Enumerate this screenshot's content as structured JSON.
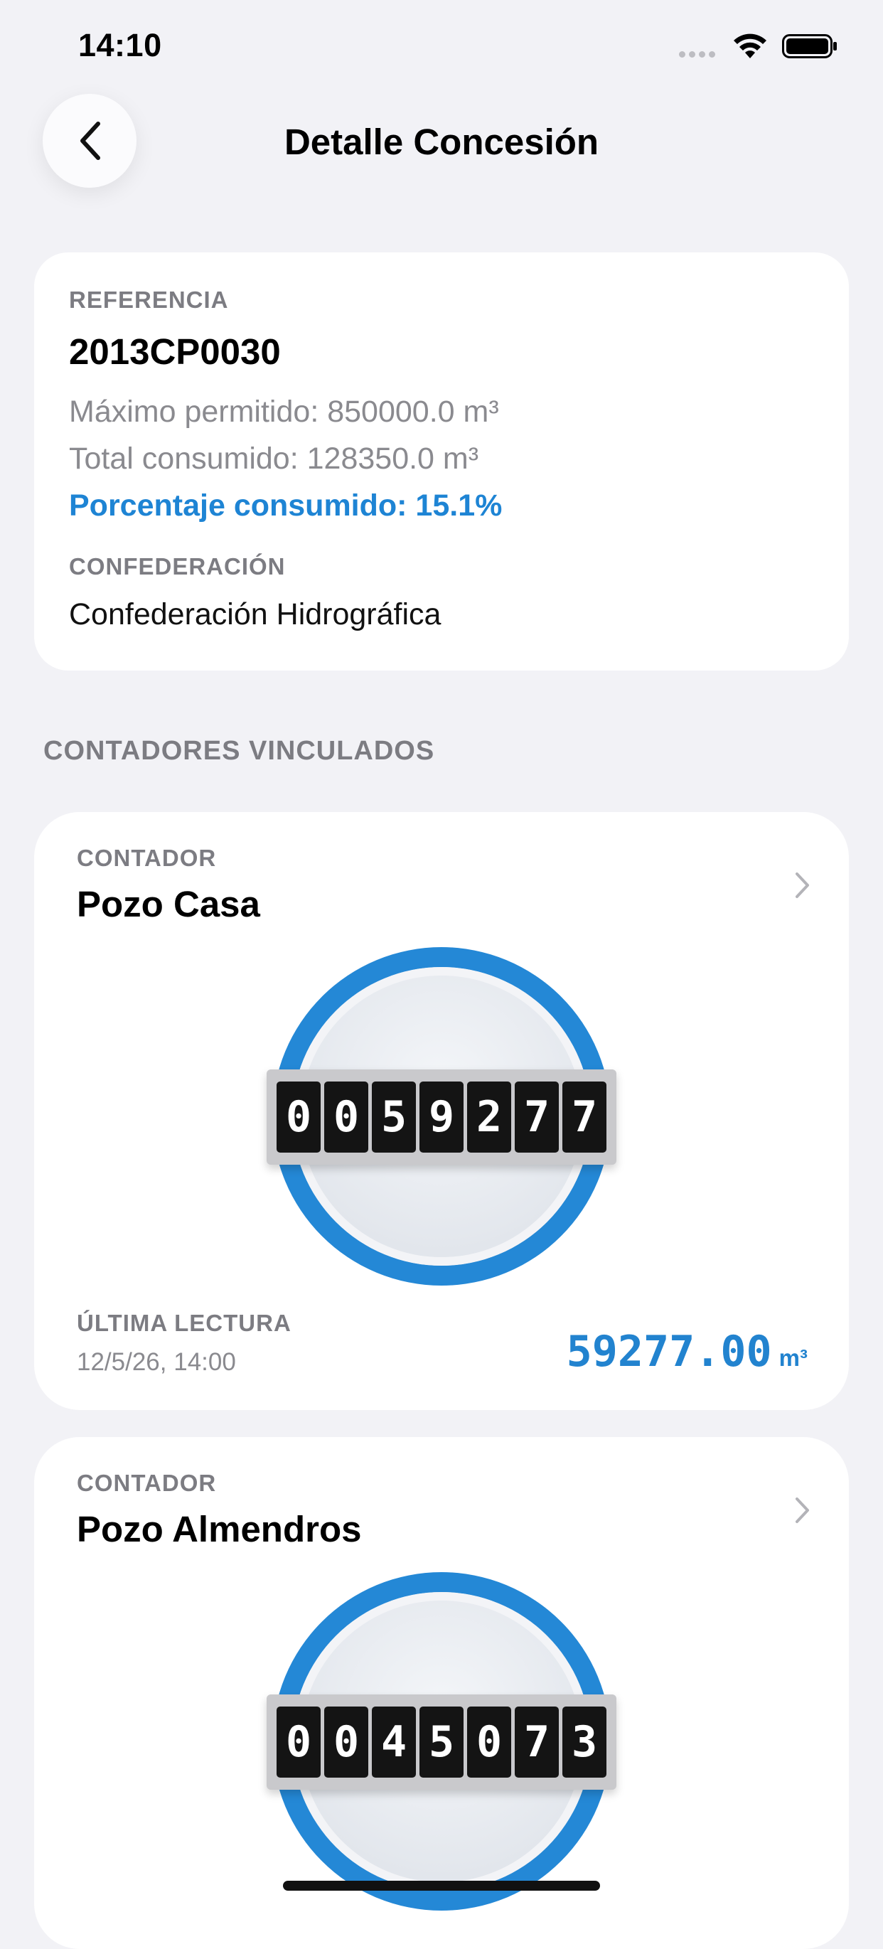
{
  "status_bar": {
    "time": "14:10"
  },
  "nav": {
    "title": "Detalle Concesión"
  },
  "concession": {
    "reference_label": "REFERENCIA",
    "reference": "2013CP0030",
    "max_allowed": "Máximo permitido: 850000.0 m³",
    "total_consumed": "Total consumido: 128350.0 m³",
    "percent_consumed": "Porcentaje consumido: 15.1%",
    "confederation_label": "CONFEDERACIÓN",
    "confederation": "Confederación Hidrográfica"
  },
  "meters_section": {
    "header": "CONTADORES VINCULADOS"
  },
  "meters": [
    {
      "label": "CONTADOR",
      "name": "Pozo Casa",
      "digits": [
        "0",
        "0",
        "5",
        "9",
        "2",
        "7",
        "7"
      ],
      "last_reading_label": "ÚLTIMA LECTURA",
      "last_reading_date": "12/5/26, 14:00",
      "reading_value": "59277.00",
      "unit": "m³"
    },
    {
      "label": "CONTADOR",
      "name": "Pozo Almendros",
      "digits": [
        "0",
        "0",
        "4",
        "5",
        "0",
        "7",
        "3"
      ]
    }
  ],
  "colors": {
    "accent": "#2488d6",
    "background": "#f2f2f6"
  }
}
